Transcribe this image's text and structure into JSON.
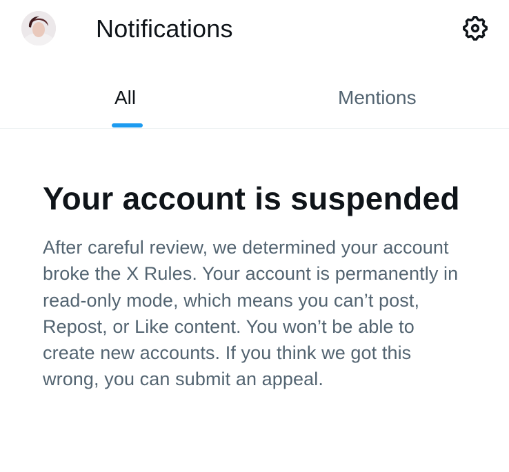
{
  "header": {
    "title": "Notifications",
    "avatar_icon": "profile-avatar",
    "settings_icon": "gear-icon"
  },
  "tabs": [
    {
      "label": "All",
      "selected": true
    },
    {
      "label": "Mentions",
      "selected": false
    }
  ],
  "notice": {
    "headline": "Your account is suspended",
    "body": "After careful review, we determined your account broke the X Rules. Your account is permanently in read-only mode, which means you can’t post, Repost, or Like content. You won’t be able to create new accounts. If you think we got this wrong, you can submit an appeal."
  },
  "colors": {
    "text_primary": "#0f1419",
    "text_secondary": "#536471",
    "accent": "#1d9bf0",
    "divider": "#eff3f4"
  }
}
